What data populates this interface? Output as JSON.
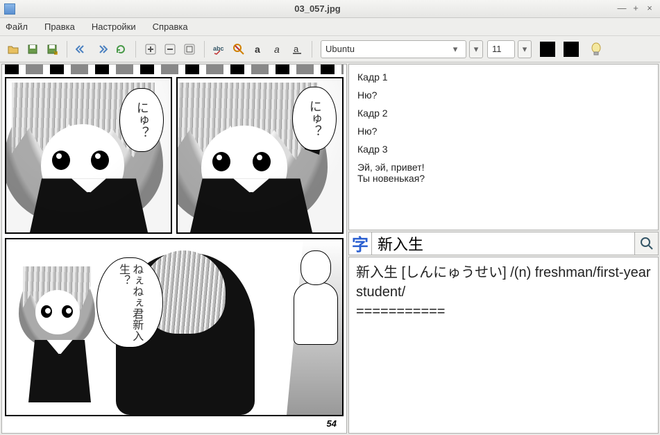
{
  "window": {
    "title": "03_057.jpg",
    "minimize": "—",
    "maximize": "+",
    "close": "×"
  },
  "menu": {
    "file": "Файл",
    "edit": "Правка",
    "settings": "Настройки",
    "help": "Справка"
  },
  "toolbar": {
    "font_family": "Ubuntu",
    "font_size": "11"
  },
  "manga": {
    "bubble_top_left": "にゅ？",
    "bubble_top_right": "にゅ？",
    "bubble_bottom": "ねぇねぇ君新入生？",
    "page_number": "54"
  },
  "translation": {
    "lines": [
      "Кадр 1",
      "Ню?",
      "Кадр 2",
      "Ню?",
      "Кадр 3",
      "Эй, эй, привет!\nТы новенькая?"
    ]
  },
  "dictionary": {
    "icon_char": "字",
    "query": "新入生",
    "result": "新入生 [しんにゅうせい] /(n) freshman/first-year student/\n==========="
  }
}
